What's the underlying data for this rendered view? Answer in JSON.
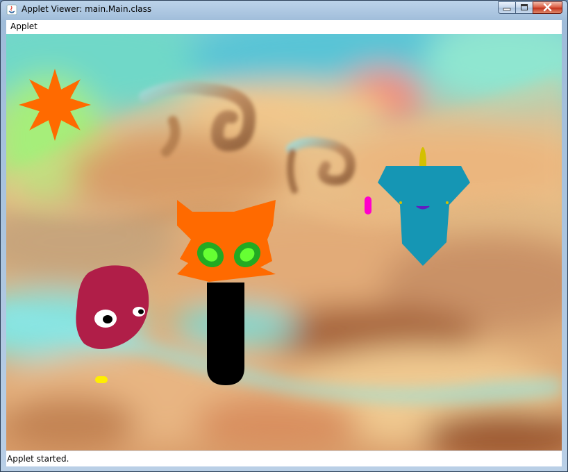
{
  "window": {
    "title": "Applet Viewer: main.Main.class",
    "controls": {
      "minimize": "minimize",
      "maximize": "maximize",
      "close": "close"
    }
  },
  "menubar": {
    "items": [
      {
        "label": "Applet"
      }
    ]
  },
  "applet": {
    "scene": {
      "characters": [
        "sun",
        "orange-cat-head",
        "blue-creature",
        "red-blob-creature",
        "black-stick-body"
      ],
      "colors": {
        "sun": "#ff6a00",
        "cat": "#ff6a00",
        "cat_eyes": "#22aa22",
        "blue_creature": "#1596b4",
        "red_blob": "#b01e48",
        "black_body": "#000000",
        "yellow_pill": "#ffee00",
        "magenta_pill": "#ff00cc",
        "yellow_antenna": "#d4c000"
      }
    }
  },
  "status": {
    "text": "Applet started."
  }
}
